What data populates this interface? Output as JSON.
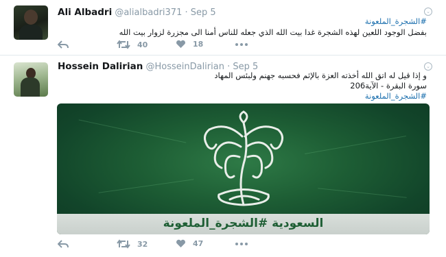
{
  "tweets": [
    {
      "name": "Ali Albadri",
      "handle": "@alialbadri371",
      "separator": "·",
      "time": "Sep 5",
      "hashtag": "#الشجرة_الملعونة",
      "text": "بفضل الوجود اللعين لهذه الشجرة غدا بيت الله الذي جعله للناس أمنا الى مجزرة لزوار بيت الله",
      "retweets": "40",
      "likes": "18"
    },
    {
      "name": "Hossein Dalirian",
      "handle": "@HosseinDalirian",
      "separator": "·",
      "time": "Sep 5",
      "text_line1": "و إذا قيل له اتق الله أخذته العزة بالإثم فحسبه جهنم ولبئس المهاد",
      "text_line2": "سورة البقرة - الآية206",
      "hashtag": "#الشجرة_الملعونة",
      "media_caption": "السعودية #الشجرة_الملعونة",
      "retweets": "32",
      "likes": "47"
    }
  ],
  "icons": {
    "reply": "reply-icon",
    "retweet": "retweet-icon",
    "like": "heart-icon",
    "more": "more-icon",
    "caret": "chevron-down-icon"
  },
  "colors": {
    "link": "#1b6fae",
    "muted": "#8899a6",
    "media_green": "#1d5d34"
  }
}
